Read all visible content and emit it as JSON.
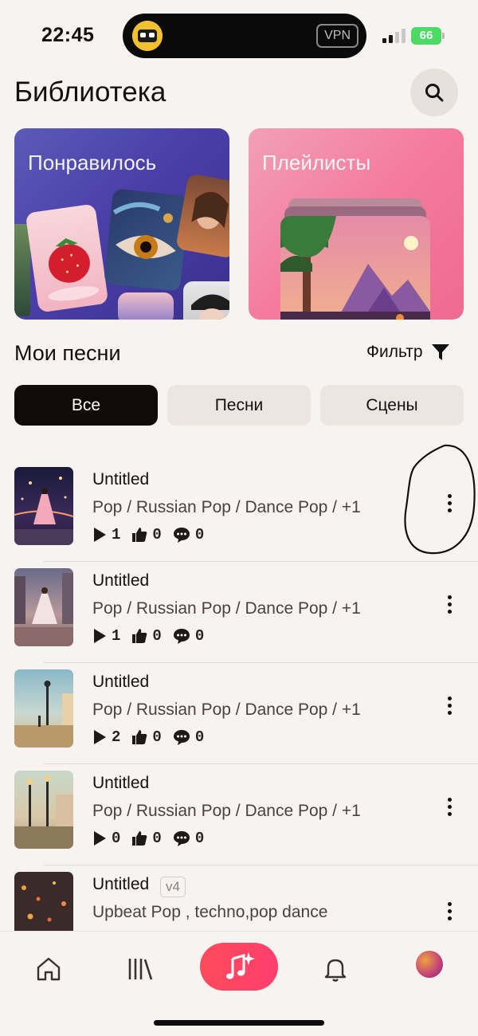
{
  "status_bar": {
    "time": "22:45",
    "vpn": "VPN",
    "battery": "66"
  },
  "header": {
    "title": "Библиотека",
    "search_icon": "search-icon"
  },
  "cards": [
    {
      "label": "Понравилось"
    },
    {
      "label": "Плейлисты"
    }
  ],
  "section": {
    "title": "Мои песни",
    "filter_label": "Фильтр"
  },
  "tabs": [
    {
      "label": "Все",
      "selected": true
    },
    {
      "label": "Песни",
      "selected": false
    },
    {
      "label": "Сцены",
      "selected": false
    }
  ],
  "songs": [
    {
      "title": "Untitled",
      "genres": "Pop / Russian Pop / Dance Pop / +1",
      "plays": "1",
      "likes": "0",
      "comments": "0"
    },
    {
      "title": "Untitled",
      "genres": "Pop / Russian Pop / Dance Pop / +1",
      "plays": "1",
      "likes": "0",
      "comments": "0"
    },
    {
      "title": "Untitled",
      "genres": "Pop / Russian Pop / Dance Pop / +1",
      "plays": "2",
      "likes": "0",
      "comments": "0"
    },
    {
      "title": "Untitled",
      "genres": "Pop / Russian Pop / Dance Pop / +1",
      "plays": "0",
      "likes": "0",
      "comments": "0"
    },
    {
      "title": "Untitled",
      "version": "v4",
      "genres": "Upbeat Pop  , techno,pop dance"
    }
  ],
  "bottom_nav": {
    "items": [
      "home-icon",
      "library-icon",
      "create-music-icon",
      "bell-icon",
      "profile-avatar"
    ]
  },
  "colors": {
    "background": "#f7f3f1",
    "accent": "#ff4a5c",
    "selected_tab": "#100a09"
  }
}
